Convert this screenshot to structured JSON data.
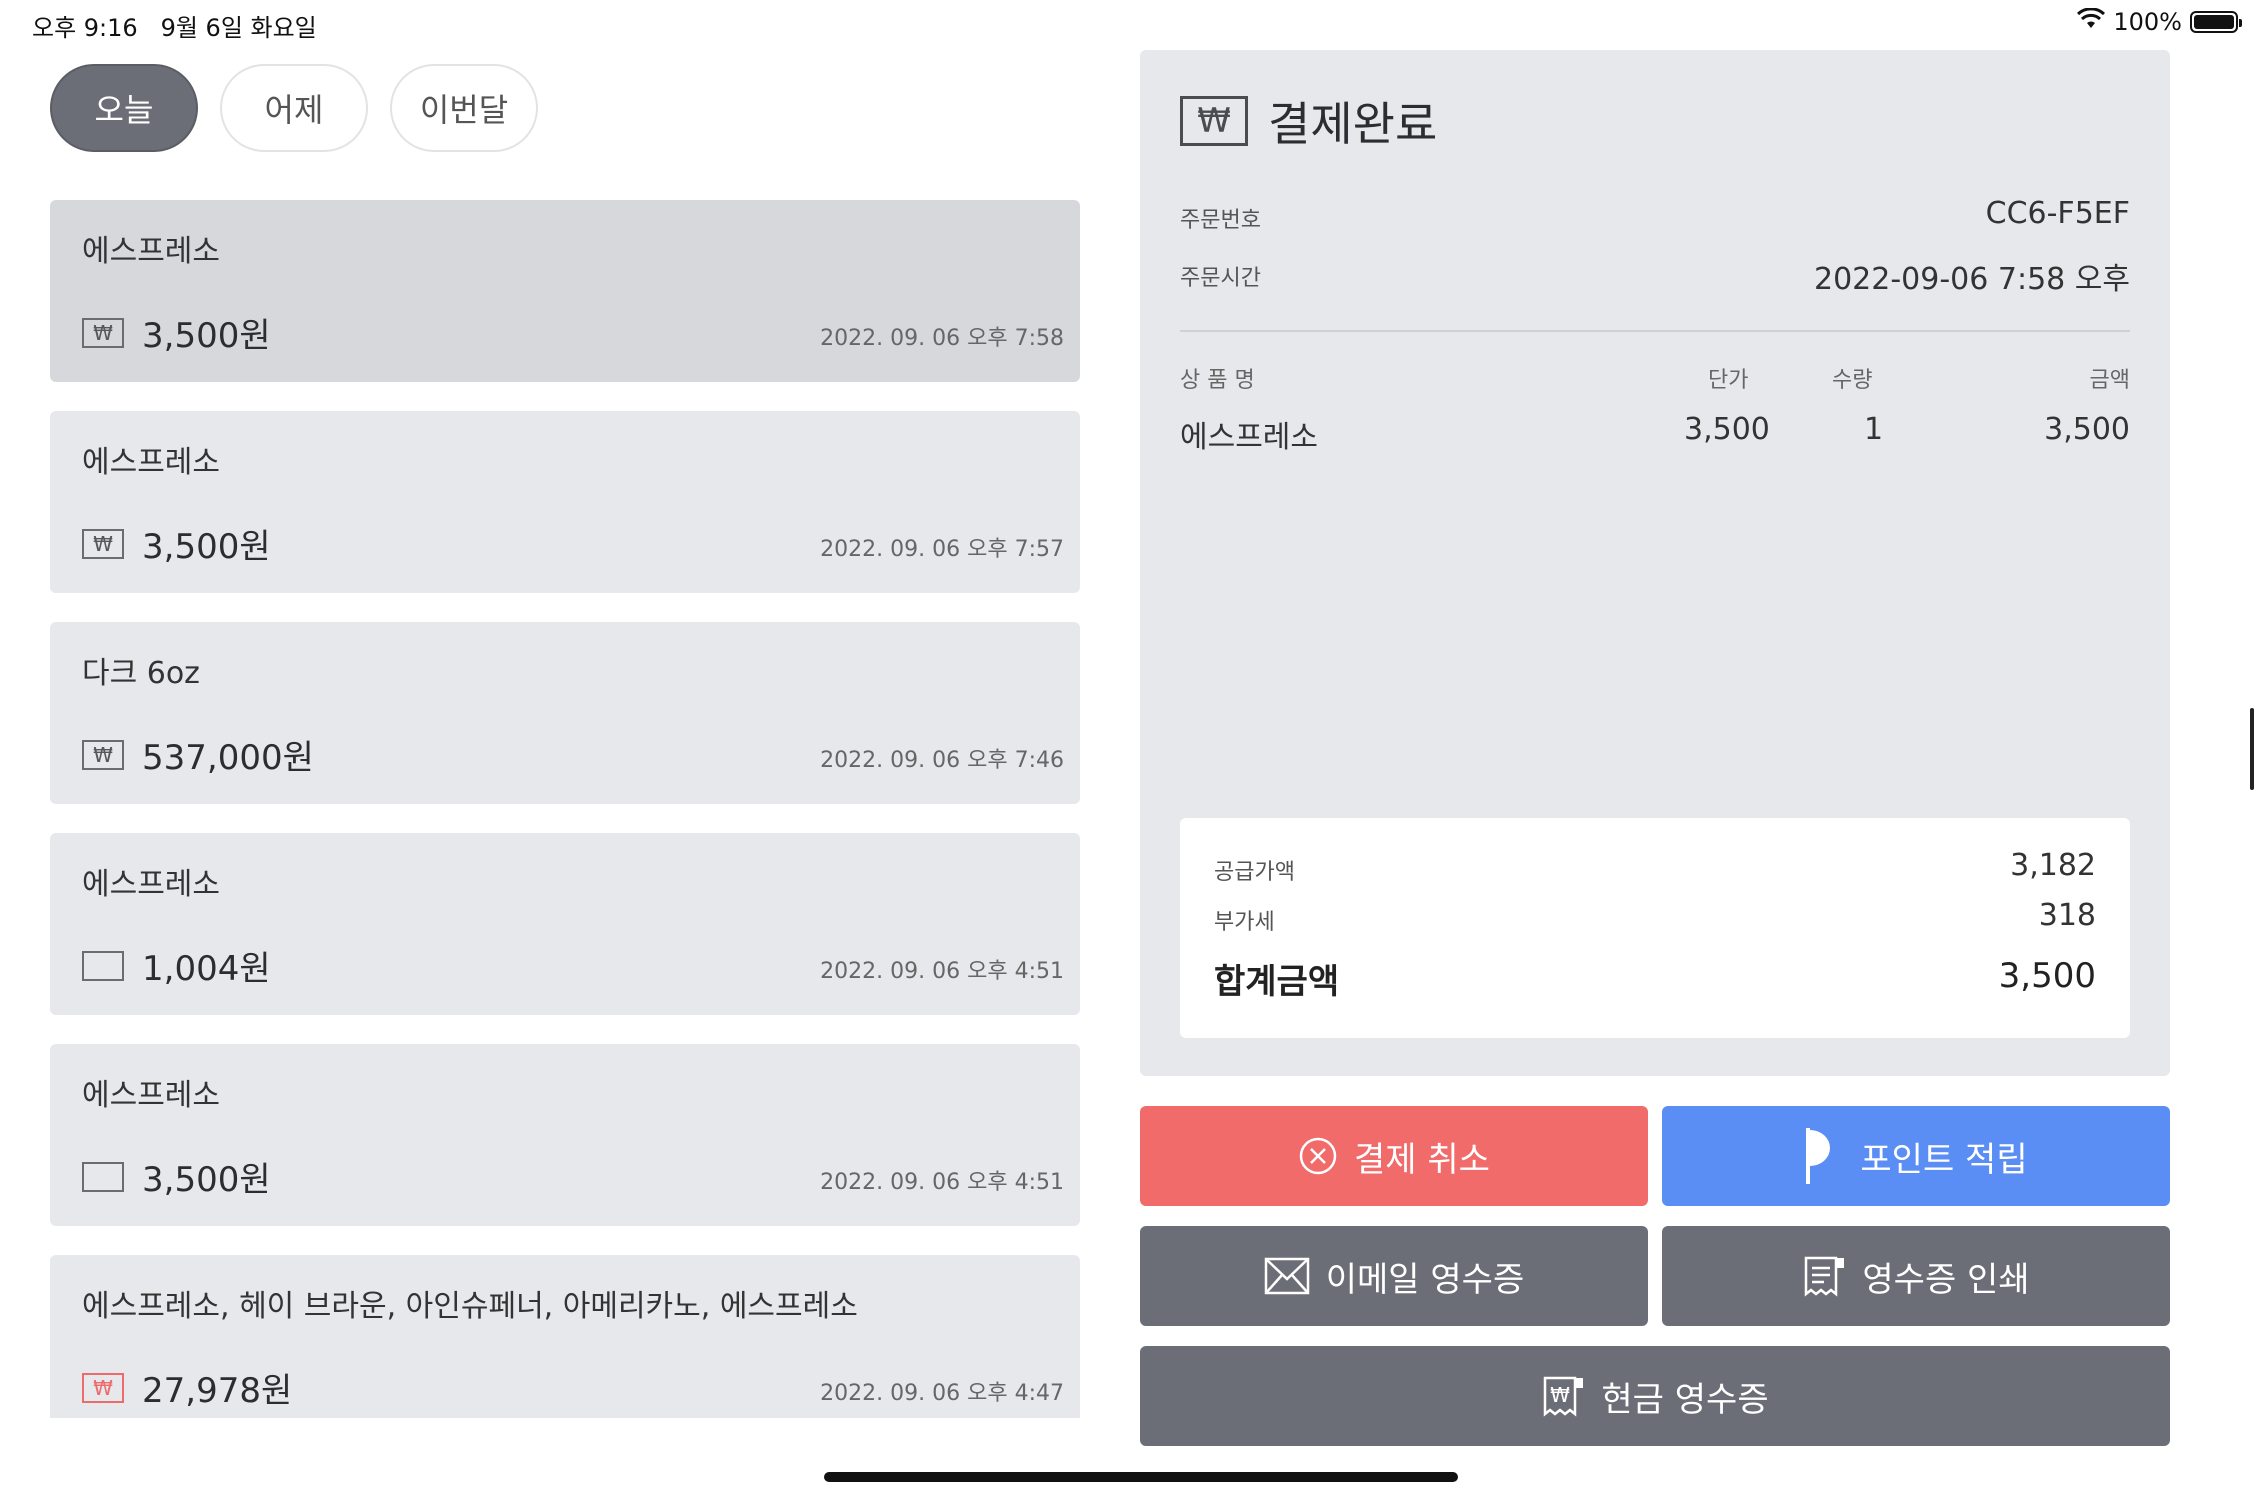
{
  "status_bar": {
    "time_date": "오후 9:16   9월 6일 화요일",
    "battery": "100%"
  },
  "filter_tabs": [
    {
      "label": "오늘",
      "active": true
    },
    {
      "label": "어제",
      "active": false
    },
    {
      "label": "이번달",
      "active": false
    }
  ],
  "orders": [
    {
      "name": "에스프레소",
      "amount": "3,500원",
      "time": "2022. 09. 06 오후 7:58",
      "pay_icon": "₩",
      "icon_color": "gray",
      "selected": true
    },
    {
      "name": "에스프레소",
      "amount": "3,500원",
      "time": "2022. 09. 06 오후 7:57",
      "pay_icon": "₩",
      "icon_color": "gray",
      "selected": false
    },
    {
      "name": "다크 6oz",
      "amount": "537,000원",
      "time": "2022. 09. 06 오후 7:46",
      "pay_icon": "₩",
      "icon_color": "gray",
      "selected": false
    },
    {
      "name": "에스프레소",
      "amount": "1,004원",
      "time": "2022. 09. 06 오후 4:51",
      "pay_icon": "",
      "icon_color": "gray",
      "selected": false
    },
    {
      "name": "에스프레소",
      "amount": "3,500원",
      "time": "2022. 09. 06 오후 4:51",
      "pay_icon": "",
      "icon_color": "gray",
      "selected": false
    },
    {
      "name": "에스프레소, 헤이 브라운, 아인슈페너, 아메리카노, 에스프레소",
      "amount": "27,978원",
      "time": "2022. 09. 06 오후 4:47",
      "pay_icon": "₩",
      "icon_color": "red",
      "selected": false
    }
  ],
  "detail": {
    "title": "결제완료",
    "title_icon": "₩",
    "order_no_label": "주문번호",
    "order_no": "CC6-F5EF",
    "order_time_label": "주문시간",
    "order_time": "2022-09-06 7:58 오후",
    "columns": {
      "name": "상 품 명",
      "unit_price": "단가",
      "qty": "수량",
      "amount": "금액"
    },
    "items": [
      {
        "name": "에스프레소",
        "unit_price": "3,500",
        "qty": "1",
        "amount": "3,500"
      }
    ],
    "summary": {
      "supply_label": "공급가액",
      "supply": "3,182",
      "vat_label": "부가세",
      "vat": "318",
      "total_label": "합계금액",
      "total": "3,500"
    }
  },
  "actions": {
    "cancel": "결제 취소",
    "points": "포인트 적립",
    "email_receipt": "이메일 영수증",
    "print_receipt": "영수증 인쇄",
    "cash_receipt": "현금 영수증"
  },
  "colors": {
    "cancel": "#f26b6b",
    "points": "#5b8ef5",
    "gray_button": "#6b6e76",
    "card_bg": "#e7e8ec",
    "card_selected": "#d7d8dc"
  }
}
